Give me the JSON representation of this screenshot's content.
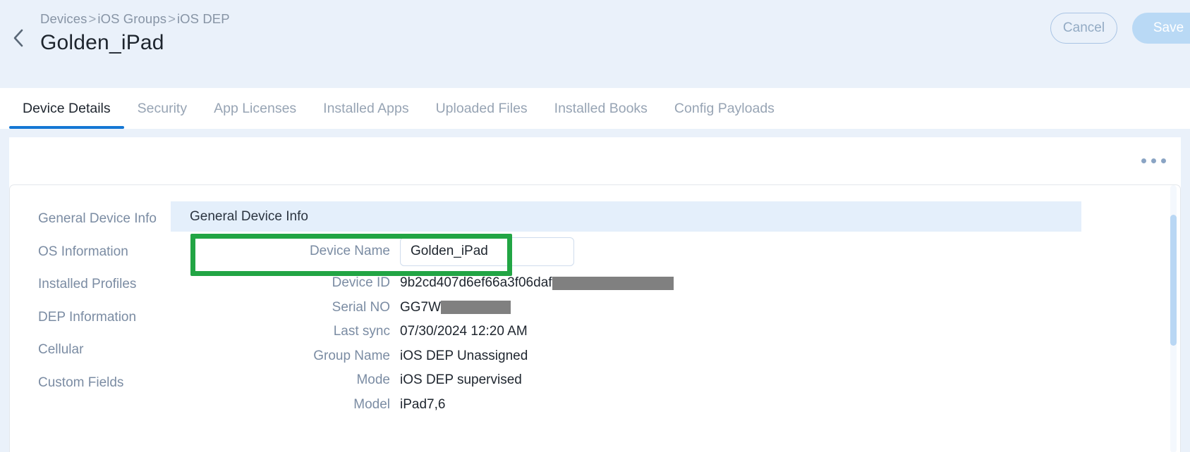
{
  "header": {
    "back_icon": "chevron-left-icon",
    "breadcrumb": [
      {
        "label": "Devices"
      },
      {
        "label": "iOS Groups"
      },
      {
        "label": "iOS DEP"
      }
    ],
    "breadcrumb_separator": ">",
    "title": "Golden_iPad",
    "cancel_label": "Cancel",
    "save_label": "Save"
  },
  "tabs": [
    {
      "label": "Device Details",
      "active": true
    },
    {
      "label": "Security",
      "active": false
    },
    {
      "label": "App Licenses",
      "active": false
    },
    {
      "label": "Installed Apps",
      "active": false
    },
    {
      "label": "Uploaded Files",
      "active": false
    },
    {
      "label": "Installed Books",
      "active": false
    },
    {
      "label": "Config Payloads",
      "active": false
    }
  ],
  "toolbar": {
    "overflow_icon": "kebab-menu-icon"
  },
  "sidebar": {
    "items": [
      {
        "label": "General Device Info"
      },
      {
        "label": "OS Information"
      },
      {
        "label": "Installed Profiles"
      },
      {
        "label": "DEP Information"
      },
      {
        "label": "Cellular"
      },
      {
        "label": "Custom Fields"
      }
    ]
  },
  "detail": {
    "section_title": "General Device Info",
    "device_name": {
      "label": "Device Name",
      "value": "Golden_iPad",
      "placeholder": "Device Name"
    },
    "fields": [
      {
        "label": "Device ID",
        "value": "9b2cd407d6ef66a3f06daf",
        "redacted": "wide"
      },
      {
        "label": "Serial NO",
        "value": "GG7W",
        "redacted": "narrow"
      },
      {
        "label": "Last sync",
        "value": "07/30/2024 12:20 AM",
        "redacted": ""
      },
      {
        "label": "Group Name",
        "value": "iOS DEP Unassigned",
        "redacted": ""
      },
      {
        "label": "Mode",
        "value": "iOS DEP supervised",
        "redacted": ""
      },
      {
        "label": "Model",
        "value": "iPad7,6",
        "redacted": ""
      }
    ]
  },
  "colors": {
    "page_background": "#eaf1fa",
    "accent_blue": "#1477d4",
    "section_header_background": "#e4effb",
    "highlight_green": "#22a544",
    "save_button_background": "#b9d9f5",
    "redaction_gray": "#808080",
    "scrollbar_thumb": "#b9d7f4"
  }
}
